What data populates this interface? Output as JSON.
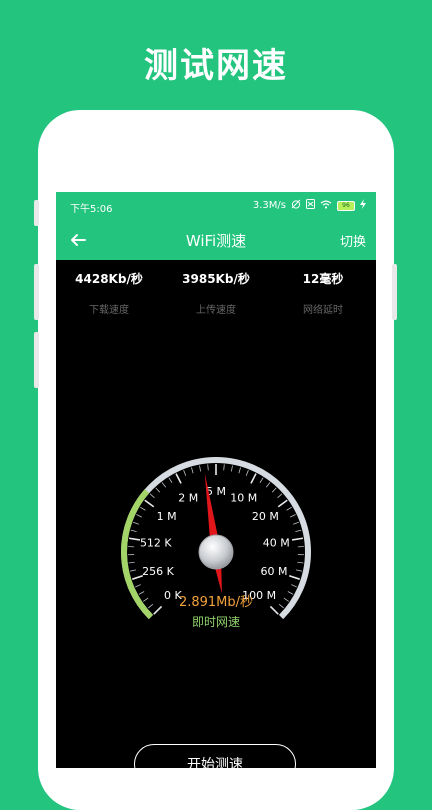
{
  "promo": {
    "title": "测试网速"
  },
  "status_bar": {
    "time": "下午5:06",
    "net_speed": "3.3M/s",
    "battery": "96"
  },
  "app_bar": {
    "back_icon": "arrow-left-icon",
    "title": "WiFi测速",
    "switch_label": "切换"
  },
  "stats": [
    {
      "value": "4428Kb/秒",
      "label": "下载速度"
    },
    {
      "value": "3985Kb/秒",
      "label": "上传速度"
    },
    {
      "value": "12毫秒",
      "label": "网络延时"
    }
  ],
  "gauge": {
    "ticks": [
      "0 K",
      "256 K",
      "512 K",
      "1 M",
      "2 M",
      "5 M",
      "10 M",
      "20 M",
      "40 M",
      "60 M",
      "100 M"
    ],
    "needle_tick_position": 4.7,
    "progress_fraction": 0.32,
    "speed_text": "2.891Mb/秒",
    "speed_label": "即时网速",
    "colors": {
      "progress": "#A3D468",
      "track": "#D7DCE2",
      "needle": "#E0161B",
      "speed": "#F2A23A",
      "label": "#8ED06A"
    }
  },
  "start_button": {
    "label": "开始测速"
  },
  "colors": {
    "brand": "#22C47E",
    "screen_bg": "#000000"
  }
}
